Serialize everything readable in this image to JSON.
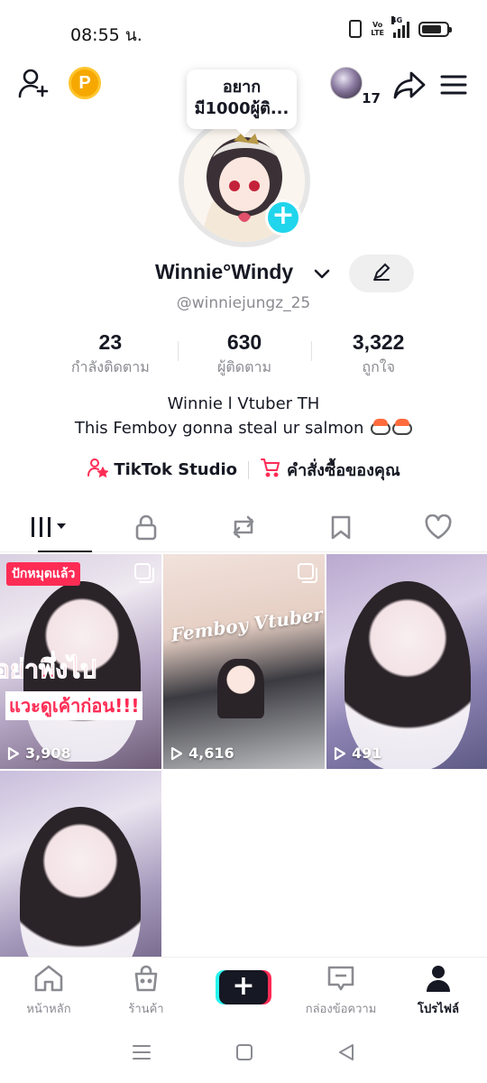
{
  "status_bar": {
    "time": "08:55 น.",
    "volte_line1": "Vo",
    "volte_line2": "LTE",
    "network": "4G",
    "battery_level": 0.8
  },
  "header": {
    "visitor_count": "17",
    "bubble_line1": "อยาก",
    "bubble_line2": "มี1000ผู้ติ..."
  },
  "profile": {
    "display_name": "Winnie°Windy",
    "username": "@winniejungz_25"
  },
  "stats": [
    {
      "value": "23",
      "label": "กำลังติดตาม"
    },
    {
      "value": "630",
      "label": "ผู้ติดตาม"
    },
    {
      "value": "3,322",
      "label": "ถูกใจ"
    }
  ],
  "bio": {
    "line1": "Winnie l Vtuber TH",
    "line2": "This Femboy gonna steal ur salmon"
  },
  "links": {
    "studio": "TikTok Studio",
    "orders": "คำสั่งซื้อของคุณ"
  },
  "videos": [
    {
      "views": "3,908",
      "badge": "ปักหมุดแล้ว",
      "overlay_big": "อย่าพึ่งไป",
      "overlay_small": "แวะดูเค้าก่อน!!!"
    },
    {
      "views": "4,616",
      "overlay": "Femboy Vtuber"
    },
    {
      "views": "491"
    },
    {}
  ],
  "bottom_nav": {
    "home": "หน้าหลัก",
    "shop": "ร้านค้า",
    "create": "+",
    "inbox": "กล่องข้อความ",
    "profile": "โปรไฟล์"
  },
  "colors": {
    "accent_red": "#fe2c55",
    "accent_cyan": "#25f4ee",
    "coin": "#f6a800"
  }
}
